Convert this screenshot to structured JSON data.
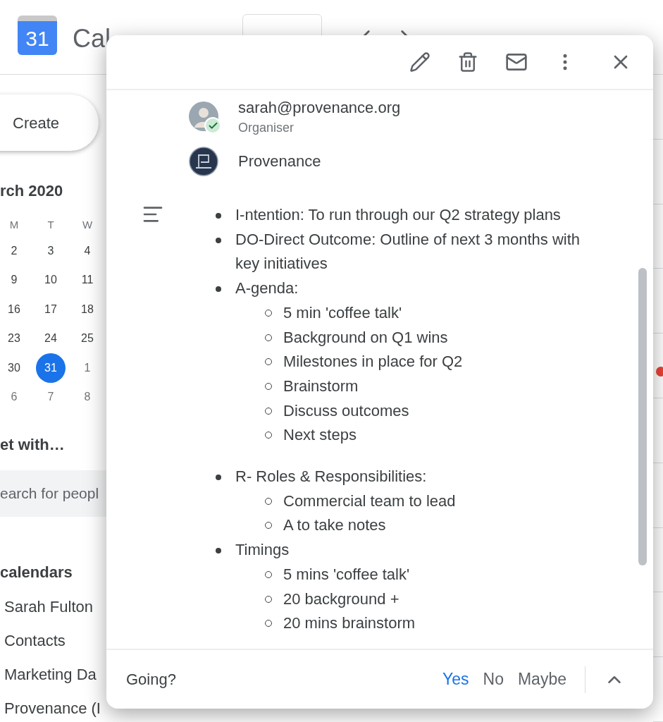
{
  "header": {
    "app_name": "Cal",
    "logo_day": "31"
  },
  "sidebar": {
    "create_button": "Create",
    "mini_calendar": {
      "month": "rch 2020",
      "weekdays": [
        "M",
        "T",
        "W"
      ],
      "weeks": [
        [
          {
            "day": "2",
            "in_month": true,
            "selected": false
          },
          {
            "day": "3",
            "in_month": true,
            "selected": false
          },
          {
            "day": "4",
            "in_month": true,
            "selected": false
          }
        ],
        [
          {
            "day": "9",
            "in_month": true,
            "selected": false
          },
          {
            "day": "10",
            "in_month": true,
            "selected": false
          },
          {
            "day": "11",
            "in_month": true,
            "selected": false
          }
        ],
        [
          {
            "day": "16",
            "in_month": true,
            "selected": false
          },
          {
            "day": "17",
            "in_month": true,
            "selected": false
          },
          {
            "day": "18",
            "in_month": true,
            "selected": false
          }
        ],
        [
          {
            "day": "23",
            "in_month": true,
            "selected": false
          },
          {
            "day": "24",
            "in_month": true,
            "selected": false
          },
          {
            "day": "25",
            "in_month": true,
            "selected": false
          }
        ],
        [
          {
            "day": "30",
            "in_month": true,
            "selected": false
          },
          {
            "day": "31",
            "in_month": true,
            "selected": true
          },
          {
            "day": "1",
            "in_month": false,
            "selected": false
          }
        ],
        [
          {
            "day": "6",
            "in_month": false,
            "selected": false
          },
          {
            "day": "7",
            "in_month": false,
            "selected": false
          },
          {
            "day": "8",
            "in_month": false,
            "selected": false
          }
        ]
      ]
    },
    "meet_with": "et with…",
    "search": {
      "placeholder": "earch for peopl"
    },
    "calendars_heading": "calendars",
    "calendars": [
      "Sarah Fulton",
      "Contacts",
      "Marketing Da",
      "Provenance (I"
    ]
  },
  "event_popup": {
    "guests": [
      {
        "name": "sarah@provenance.org",
        "role": "Organiser",
        "kind": "person",
        "accepted": true
      },
      {
        "name": "Provenance",
        "kind": "group",
        "accepted": false
      }
    ],
    "description": [
      {
        "kind": "bullet",
        "text": "I-ntention: To run through our Q2 strategy plans"
      },
      {
        "kind": "bullet",
        "text": "DO-Direct Outcome: Outline of next 3 months with key initiatives"
      },
      {
        "kind": "bullet",
        "text": "A-genda:",
        "children": [
          {
            "text": "5 min 'coffee talk'"
          },
          {
            "text": "Background on Q1 wins"
          },
          {
            "text": "Milestones in place for Q2"
          },
          {
            "text": "Brainstorm"
          },
          {
            "text": "Discuss outcomes"
          },
          {
            "text": "Next steps"
          }
        ]
      },
      {
        "kind": "blank_line"
      },
      {
        "kind": "bullet",
        "text": "R- Roles & Responsibilities:",
        "children": [
          {
            "text": "Commercial team to lead"
          },
          {
            "text": "A to take notes"
          }
        ]
      },
      {
        "kind": "bullet",
        "text": "Timings",
        "children": [
          {
            "text": "5 mins 'coffee talk'"
          },
          {
            "text": "20 background +"
          },
          {
            "text": "20 mins brainstorm"
          }
        ]
      }
    ],
    "rsvp": {
      "label": "Going?",
      "options": [
        {
          "label": "Yes",
          "selected": true
        },
        {
          "label": "No",
          "selected": false
        },
        {
          "label": "Maybe",
          "selected": false
        }
      ]
    }
  }
}
